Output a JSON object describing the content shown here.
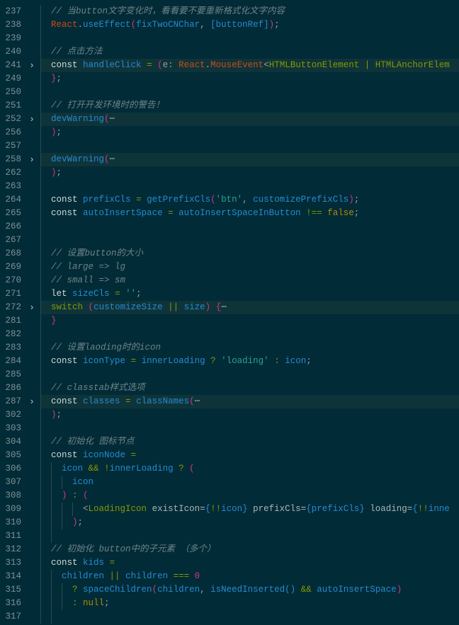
{
  "colors": {
    "background": "#012b37",
    "folded_highlight": "#0e343a",
    "keyword": "#859900",
    "variable": "#268bd2",
    "string": "#2aa198",
    "comment": "#6f8489"
  },
  "lines": [
    {
      "num": "237",
      "tokens": [
        [
          "w",
          "  "
        ],
        [
          "c",
          "// 当button文字变化时，看看要不要重新格式化文字内容"
        ]
      ]
    },
    {
      "num": "238",
      "tokens": [
        [
          "w",
          "  "
        ],
        [
          "r",
          "React"
        ],
        [
          "w",
          "."
        ],
        [
          "v",
          "useEffect"
        ],
        [
          "p",
          "("
        ],
        [
          "v",
          "fixTwoCNChar"
        ],
        [
          "w",
          ", "
        ],
        [
          "b",
          "["
        ],
        [
          "v",
          "buttonRef"
        ],
        [
          "b",
          "]"
        ],
        [
          "p",
          ")"
        ],
        [
          "w",
          ";"
        ]
      ]
    },
    {
      "num": "239",
      "tokens": []
    },
    {
      "num": "240",
      "tokens": [
        [
          "w",
          "  "
        ],
        [
          "c",
          "// 点击方法 "
        ]
      ]
    },
    {
      "num": "241",
      "fold": true,
      "tokens": [
        [
          "w",
          "  "
        ],
        [
          "k",
          "const"
        ],
        [
          "w",
          " "
        ],
        [
          "v",
          "handleClick"
        ],
        [
          "w",
          " "
        ],
        [
          "o",
          "="
        ],
        [
          "w",
          " "
        ],
        [
          "p",
          "("
        ],
        [
          "e",
          "e: "
        ],
        [
          "r",
          "React"
        ],
        [
          "w",
          "."
        ],
        [
          "r",
          "MouseEvent"
        ],
        [
          "w",
          "<"
        ],
        [
          "t",
          "HTMLButtonElement"
        ],
        [
          "w",
          " "
        ],
        [
          "o",
          "|"
        ],
        [
          "w",
          " "
        ],
        [
          "t",
          "HTMLAnchorElem"
        ]
      ]
    },
    {
      "num": "249",
      "tokens": [
        [
          "w",
          "  "
        ],
        [
          "p",
          "}"
        ],
        [
          "w",
          ";"
        ]
      ]
    },
    {
      "num": "250",
      "tokens": []
    },
    {
      "num": "251",
      "tokens": [
        [
          "w",
          "  "
        ],
        [
          "c",
          "// 打开开发环境时的警告！"
        ]
      ]
    },
    {
      "num": "252",
      "fold": true,
      "tokens": [
        [
          "w",
          "  "
        ],
        [
          "v",
          "devWarning"
        ],
        [
          "p",
          "("
        ],
        [
          "w",
          "⋯"
        ]
      ]
    },
    {
      "num": "256",
      "tokens": [
        [
          "w",
          "  "
        ],
        [
          "p",
          ")"
        ],
        [
          "w",
          ";"
        ]
      ]
    },
    {
      "num": "257",
      "tokens": []
    },
    {
      "num": "258",
      "fold": true,
      "tokens": [
        [
          "w",
          "  "
        ],
        [
          "v",
          "devWarning"
        ],
        [
          "p",
          "("
        ],
        [
          "w",
          "⋯"
        ]
      ]
    },
    {
      "num": "262",
      "tokens": [
        [
          "w",
          "  "
        ],
        [
          "p",
          ")"
        ],
        [
          "w",
          ";"
        ]
      ]
    },
    {
      "num": "263",
      "tokens": []
    },
    {
      "num": "264",
      "tokens": [
        [
          "w",
          "  "
        ],
        [
          "k",
          "const"
        ],
        [
          "w",
          " "
        ],
        [
          "v",
          "prefixCls"
        ],
        [
          "w",
          " "
        ],
        [
          "o",
          "="
        ],
        [
          "w",
          " "
        ],
        [
          "v",
          "getPrefixCls"
        ],
        [
          "p",
          "("
        ],
        [
          "s",
          "'btn'"
        ],
        [
          "w",
          ", "
        ],
        [
          "v",
          "customizePrefixCls"
        ],
        [
          "p",
          ")"
        ],
        [
          "w",
          ";"
        ]
      ]
    },
    {
      "num": "265",
      "tokens": [
        [
          "w",
          "  "
        ],
        [
          "k",
          "const"
        ],
        [
          "w",
          " "
        ],
        [
          "v",
          "autoInsertSpace"
        ],
        [
          "w",
          " "
        ],
        [
          "o",
          "="
        ],
        [
          "w",
          " "
        ],
        [
          "v",
          "autoInsertSpaceInButton"
        ],
        [
          "w",
          " "
        ],
        [
          "o",
          "!=="
        ],
        [
          "w",
          " "
        ],
        [
          "y",
          "false"
        ],
        [
          "w",
          ";"
        ]
      ]
    },
    {
      "num": "266",
      "tokens": []
    },
    {
      "num": "267",
      "tokens": []
    },
    {
      "num": "268",
      "tokens": [
        [
          "w",
          "  "
        ],
        [
          "c",
          "// 设置button的大小"
        ]
      ]
    },
    {
      "num": "269",
      "tokens": [
        [
          "w",
          "  "
        ],
        [
          "c",
          "// large => lg"
        ]
      ]
    },
    {
      "num": "270",
      "tokens": [
        [
          "w",
          "  "
        ],
        [
          "c",
          "// small => sm"
        ]
      ]
    },
    {
      "num": "271",
      "tokens": [
        [
          "w",
          "  "
        ],
        [
          "k",
          "let"
        ],
        [
          "w",
          " "
        ],
        [
          "v",
          "sizeCls"
        ],
        [
          "w",
          " "
        ],
        [
          "o",
          "="
        ],
        [
          "w",
          " "
        ],
        [
          "s",
          "''"
        ],
        [
          "w",
          ";"
        ]
      ]
    },
    {
      "num": "272",
      "fold": true,
      "tokens": [
        [
          "w",
          "  "
        ],
        [
          "kw",
          "switch"
        ],
        [
          "w",
          " "
        ],
        [
          "p",
          "("
        ],
        [
          "v",
          "customizeSize"
        ],
        [
          "w",
          " "
        ],
        [
          "o",
          "||"
        ],
        [
          "w",
          " "
        ],
        [
          "v",
          "size"
        ],
        [
          "p",
          ")"
        ],
        [
          "w",
          " "
        ],
        [
          "p",
          "{"
        ],
        [
          "w",
          "⋯"
        ]
      ]
    },
    {
      "num": "281",
      "tokens": [
        [
          "w",
          "  "
        ],
        [
          "p",
          "}"
        ]
      ]
    },
    {
      "num": "282",
      "tokens": []
    },
    {
      "num": "283",
      "tokens": [
        [
          "w",
          "  "
        ],
        [
          "c",
          "// 设置laoding时的icon"
        ]
      ]
    },
    {
      "num": "284",
      "tokens": [
        [
          "w",
          "  "
        ],
        [
          "k",
          "const"
        ],
        [
          "w",
          " "
        ],
        [
          "v",
          "iconType"
        ],
        [
          "w",
          " "
        ],
        [
          "o",
          "="
        ],
        [
          "w",
          " "
        ],
        [
          "v",
          "innerLoading"
        ],
        [
          "w",
          " "
        ],
        [
          "o",
          "?"
        ],
        [
          "w",
          " "
        ],
        [
          "s",
          "'loading'"
        ],
        [
          "w",
          " "
        ],
        [
          "o",
          ":"
        ],
        [
          "w",
          " "
        ],
        [
          "v",
          "icon"
        ],
        [
          "w",
          ";"
        ]
      ]
    },
    {
      "num": "285",
      "tokens": []
    },
    {
      "num": "286",
      "tokens": [
        [
          "w",
          "  "
        ],
        [
          "c",
          "// classtab样式选项"
        ]
      ]
    },
    {
      "num": "287",
      "fold": true,
      "tokens": [
        [
          "w",
          "  "
        ],
        [
          "k",
          "const"
        ],
        [
          "w",
          " "
        ],
        [
          "v",
          "classes"
        ],
        [
          "w",
          " "
        ],
        [
          "o",
          "="
        ],
        [
          "w",
          " "
        ],
        [
          "v",
          "classNames"
        ],
        [
          "p",
          "("
        ],
        [
          "w",
          "⋯"
        ]
      ]
    },
    {
      "num": "302",
      "tokens": [
        [
          "w",
          "  "
        ],
        [
          "p",
          ")"
        ],
        [
          "w",
          ";"
        ]
      ]
    },
    {
      "num": "303",
      "tokens": []
    },
    {
      "num": "304",
      "tokens": [
        [
          "w",
          "  "
        ],
        [
          "c",
          "// 初始化 图标节点"
        ]
      ]
    },
    {
      "num": "305",
      "tokens": [
        [
          "w",
          "  "
        ],
        [
          "k",
          "const"
        ],
        [
          "w",
          " "
        ],
        [
          "v",
          "iconNode"
        ],
        [
          "w",
          " "
        ],
        [
          "o",
          "="
        ]
      ]
    },
    {
      "num": "306",
      "tokens": [
        [
          "w",
          "    "
        ],
        [
          "v",
          "icon"
        ],
        [
          "w",
          " "
        ],
        [
          "o",
          "&&"
        ],
        [
          "w",
          " "
        ],
        [
          "o",
          "!"
        ],
        [
          "v",
          "innerLoading"
        ],
        [
          "w",
          " "
        ],
        [
          "o",
          "?"
        ],
        [
          "w",
          " "
        ],
        [
          "p",
          "("
        ]
      ]
    },
    {
      "num": "307",
      "tokens": [
        [
          "w",
          "      "
        ],
        [
          "v",
          "icon"
        ]
      ]
    },
    {
      "num": "308",
      "tokens": [
        [
          "w",
          "    "
        ],
        [
          "p",
          ")"
        ],
        [
          "w",
          " "
        ],
        [
          "o",
          ":"
        ],
        [
          "w",
          " "
        ],
        [
          "p",
          "("
        ]
      ]
    },
    {
      "num": "309",
      "tokens": [
        [
          "w",
          "        "
        ],
        [
          "w",
          "<"
        ],
        [
          "t",
          "LoadingIcon"
        ],
        [
          "w",
          " "
        ],
        [
          "a",
          "existIcon="
        ],
        [
          "b",
          "{"
        ],
        [
          "o",
          "!!"
        ],
        [
          "v",
          "icon"
        ],
        [
          "b",
          "}"
        ],
        [
          "w",
          " "
        ],
        [
          "a",
          "prefixCls="
        ],
        [
          "b",
          "{"
        ],
        [
          "v",
          "prefixCls"
        ],
        [
          "b",
          "}"
        ],
        [
          "w",
          " "
        ],
        [
          "a",
          "loading="
        ],
        [
          "b",
          "{"
        ],
        [
          "o",
          "!!"
        ],
        [
          "v",
          "inne"
        ]
      ]
    },
    {
      "num": "310",
      "tokens": [
        [
          "w",
          "      "
        ],
        [
          "p",
          ")"
        ],
        [
          "w",
          ";"
        ]
      ]
    },
    {
      "num": "311",
      "tokens": []
    },
    {
      "num": "312",
      "tokens": [
        [
          "w",
          "  "
        ],
        [
          "c",
          "// 初始化 button中的子元素 （多个）"
        ]
      ]
    },
    {
      "num": "313",
      "tokens": [
        [
          "w",
          "  "
        ],
        [
          "k",
          "const"
        ],
        [
          "w",
          " "
        ],
        [
          "v",
          "kids"
        ],
        [
          "w",
          " "
        ],
        [
          "o",
          "="
        ]
      ]
    },
    {
      "num": "314",
      "tokens": [
        [
          "w",
          "    "
        ],
        [
          "v",
          "children"
        ],
        [
          "w",
          " "
        ],
        [
          "o",
          "||"
        ],
        [
          "w",
          " "
        ],
        [
          "v",
          "children"
        ],
        [
          "w",
          " "
        ],
        [
          "o",
          "==="
        ],
        [
          "w",
          " "
        ],
        [
          "n",
          "0"
        ]
      ]
    },
    {
      "num": "315",
      "tokens": [
        [
          "w",
          "      "
        ],
        [
          "o",
          "?"
        ],
        [
          "w",
          " "
        ],
        [
          "v",
          "spaceChildren"
        ],
        [
          "p",
          "("
        ],
        [
          "v",
          "children"
        ],
        [
          "w",
          ", "
        ],
        [
          "v",
          "isNeedInserted"
        ],
        [
          "b",
          "()"
        ],
        [
          "w",
          " "
        ],
        [
          "o",
          "&&"
        ],
        [
          "w",
          " "
        ],
        [
          "v",
          "autoInsertSpace"
        ],
        [
          "p",
          ")"
        ]
      ]
    },
    {
      "num": "316",
      "tokens": [
        [
          "w",
          "      "
        ],
        [
          "o",
          ":"
        ],
        [
          "w",
          " "
        ],
        [
          "y",
          "null"
        ],
        [
          "w",
          ";"
        ]
      ]
    },
    {
      "num": "317",
      "tokens": []
    }
  ]
}
